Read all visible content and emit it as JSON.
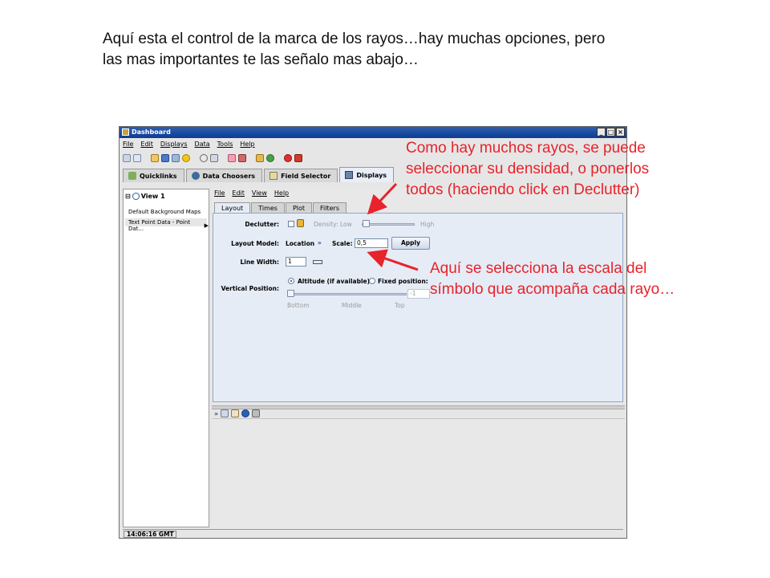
{
  "caption": {
    "line1": "Aquí esta el control de la marca de los rayos…hay muchas opciones, pero",
    "line2": "las mas importantes te las señalo mas abajo…"
  },
  "annotations": {
    "density": {
      "line1": "Como hay muchos rayos, se puede",
      "line2": "seleccionar su densidad, o ponerlos",
      "line3": "todos (haciendo click en Declutter)"
    },
    "scale": {
      "line1": "Aquí se selecciona la escala del",
      "line2": "símbolo que acompaña cada rayo…"
    }
  },
  "window": {
    "title": "Dashboard",
    "menu": [
      "File",
      "Edit",
      "Displays",
      "Data",
      "Tools",
      "Help"
    ],
    "tabs": [
      {
        "label": "Quicklinks"
      },
      {
        "label": "Data Choosers"
      },
      {
        "label": "Field Selector"
      },
      {
        "label": "Displays"
      }
    ],
    "tree": {
      "view": "View 1",
      "items": [
        "Default Background Maps",
        "Text Point Data - Point Dat..."
      ]
    },
    "display_menu": [
      "File",
      "Edit",
      "View",
      "Help"
    ],
    "display_tabs": [
      "Layout",
      "Times",
      "Plot",
      "Filters"
    ],
    "layout": {
      "declutter_label": "Declutter:",
      "density_label": "Density:",
      "density_low": "Low",
      "density_high": "High",
      "layout_model_label": "Layout Model:",
      "layout_model_value": "Location",
      "scale_label": "Scale:",
      "scale_value": "0,5",
      "apply": "Apply",
      "line_width_label": "Line Width:",
      "line_width_value": "1",
      "vertical_position_label": "Vertical Position:",
      "altitude_option": "Altitude (if available)",
      "fixed_option": "Fixed position:",
      "fixed_value": "-1",
      "slider_bottom": "Bottom",
      "slider_middle": "Middle",
      "slider_top": "Top"
    },
    "status_time": "14:06:16 GMT"
  }
}
